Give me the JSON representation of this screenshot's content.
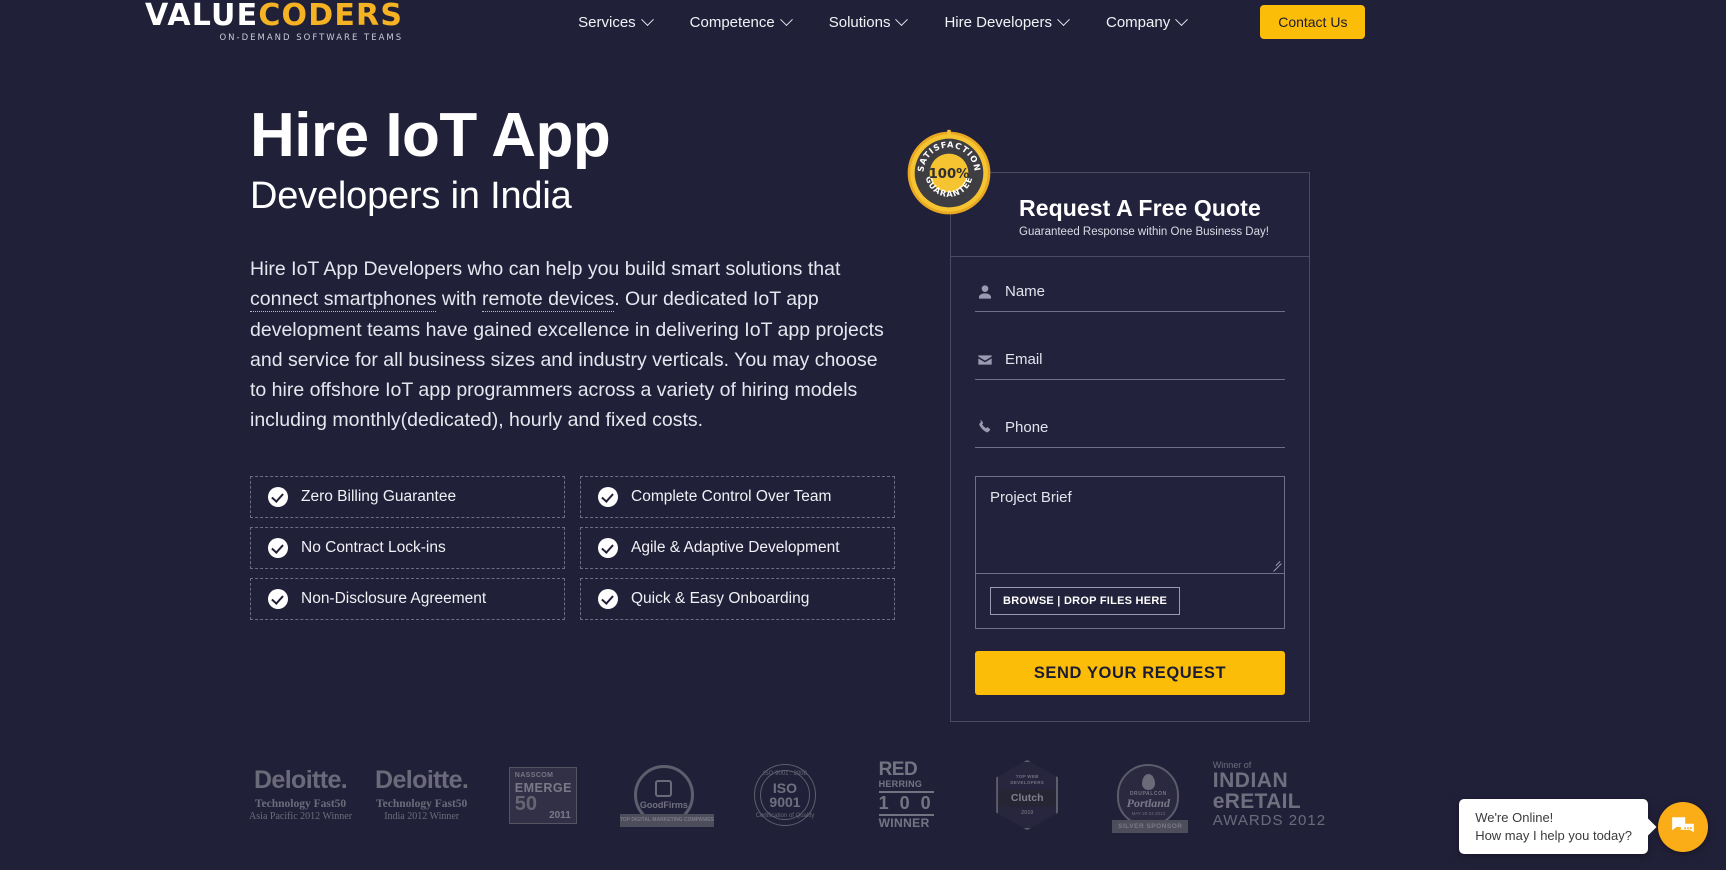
{
  "header": {
    "logo": {
      "part1": "VALUE",
      "part2": "CODERS",
      "tagline": "ON-DEMAND SOFTWARE TEAMS"
    },
    "nav": [
      {
        "label": "Services"
      },
      {
        "label": "Competence"
      },
      {
        "label": "Solutions"
      },
      {
        "label": "Hire Developers"
      },
      {
        "label": "Company"
      }
    ],
    "contact_label": "Contact Us"
  },
  "hero": {
    "title": "Hire IoT App",
    "subtitle": "Developers in India",
    "paragraph": {
      "p1": "Hire IoT App Developers who can help you build smart solutions that ",
      "link1": "connect smartphones",
      "p2": " with ",
      "link2": "remote devices",
      "p3": ". Our dedicated IoT app development teams have gained excellence in delivering IoT app projects and service for all business sizes and industry verticals. You may choose to hire offshore IoT app programmers across a variety of hiring models including monthly(dedicated), hourly and fixed costs."
    },
    "features": [
      {
        "label": "Zero Billing Guarantee"
      },
      {
        "label": "Complete Control Over Team"
      },
      {
        "label": "No Contract Lock-ins"
      },
      {
        "label": "Agile & Adaptive Development"
      },
      {
        "label": "Non-Disclosure Agreement"
      },
      {
        "label": "Quick & Easy Onboarding"
      }
    ]
  },
  "seal": {
    "top_text": "SATISFACTION",
    "center_text": "100%",
    "bottom_text": "GUARANTEE"
  },
  "form": {
    "title": "Request A Free Quote",
    "subtitle": "Guaranteed Response within One Business Day!",
    "name_placeholder": "Name",
    "email_placeholder": "Email",
    "phone_placeholder": "Phone",
    "brief_placeholder": "Project Brief",
    "browse_label": "BROWSE | DROP FILES HERE",
    "submit_label": "SEND YOUR REQUEST"
  },
  "awards": [
    {
      "name": "Deloitte.",
      "line1": "Technology Fast50",
      "line2": "Asia Pacific 2012 Winner"
    },
    {
      "name": "Deloitte.",
      "line1": "Technology Fast50",
      "line2": "India 2012 Winner"
    },
    {
      "brand": "NASSCOM",
      "word": "EMERGE",
      "number": "50",
      "year": "2011"
    },
    {
      "name": "GoodFirms",
      "ribbon": "TOP DIGITAL MARKETING COMPANIES"
    },
    {
      "arc_top": "ISO 9001 : 2008",
      "line1": "ISO",
      "line2": "9001",
      "arc_bottom": "Certification of Quality"
    },
    {
      "word1": "RED",
      "word2": "HERRING",
      "number": "1 0 0",
      "word3": "WINNER"
    },
    {
      "top": "TOP WEB DEVELOPERS",
      "name": "Clutch",
      "year": "2019"
    },
    {
      "con": "DRUPALCON",
      "city": "Portland",
      "date": "MAY 20-24 2013",
      "sponsor": "SILVER SPONSOR"
    },
    {
      "winner": "Winner of",
      "line1": "INDIAN",
      "line2": "eRETAIL",
      "line3": "AWARDS 2012"
    }
  ],
  "chat": {
    "line1": "We're Online!",
    "line2": "How may I help you today?"
  },
  "colors": {
    "background": "#212039",
    "accent": "#fbbd08",
    "logo_accent": "#f5b223",
    "chat_accent": "#fbad18"
  }
}
